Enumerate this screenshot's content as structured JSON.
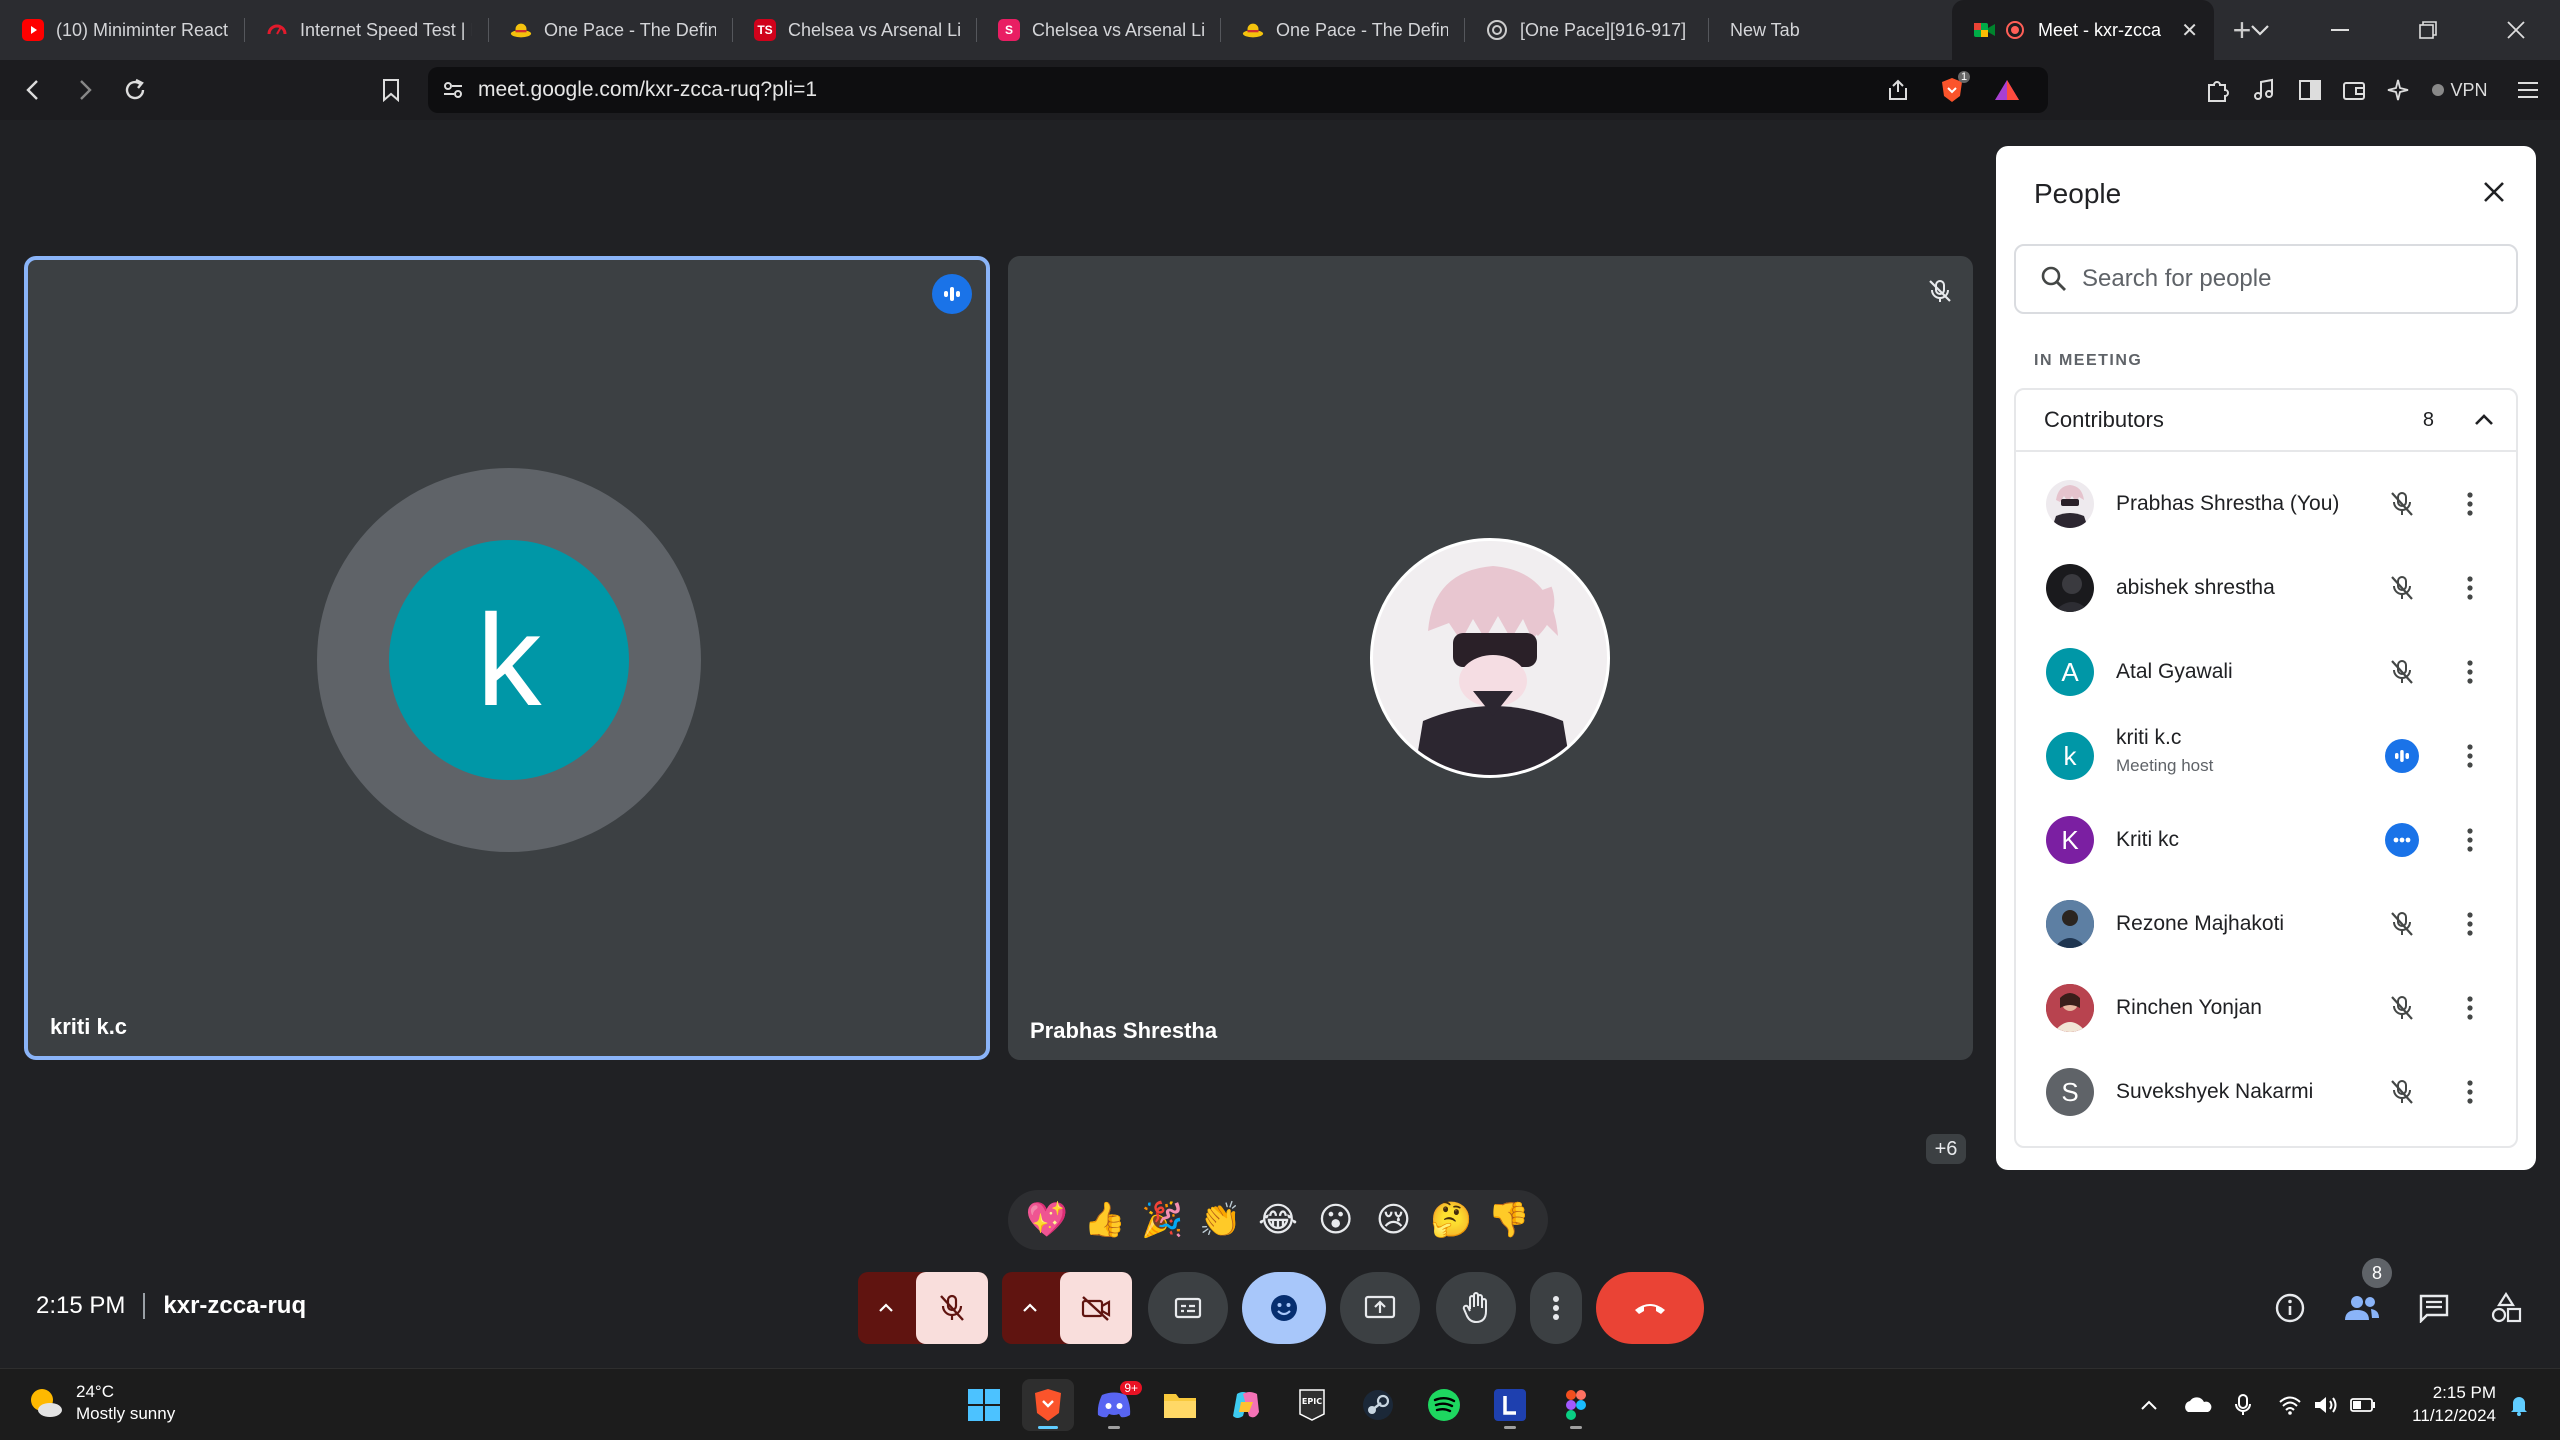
{
  "browser": {
    "tabs": [
      {
        "label": "(10) Miniminter React",
        "favicon": "youtube-icon",
        "color": "#ff0000"
      },
      {
        "label": "Internet Speed Test | F",
        "favicon": "speedtest-icon",
        "color": "#e21a2c"
      },
      {
        "label": "One Pace - The Definit",
        "favicon": "strawhat-icon",
        "color": "#f4c20d"
      },
      {
        "label": "Chelsea vs Arsenal Liv",
        "favicon": "ts-icon",
        "color": "#d0021b"
      },
      {
        "label": "Chelsea vs Arsenal Liv",
        "favicon": "s-icon",
        "color": "#e91e63"
      },
      {
        "label": "One Pace - The Definit",
        "favicon": "strawhat-icon",
        "color": "#f4c20d"
      },
      {
        "label": "[One Pace][916-917] ",
        "favicon": "opera-icon",
        "color": "#cccccc"
      },
      {
        "label": "New Tab",
        "favicon": "",
        "color": ""
      },
      {
        "label": "Meet - kxr-zcca",
        "favicon": "meet-icon",
        "color": "#00ac47",
        "active": true
      }
    ],
    "url": "meet.google.com/kxr-zcca-ruq?pli=1",
    "vpn_label": "VPN",
    "shields_badge": "1"
  },
  "meet": {
    "tiles": [
      {
        "name": "kriti k.c",
        "initial": "k"
      },
      {
        "name": "Prabhas Shrestha"
      }
    ],
    "more_count": "+6",
    "reactions": [
      "💖",
      "👍",
      "🎉",
      "👏",
      "😂",
      "😮",
      "😢",
      "🤔",
      "👎"
    ],
    "time": "2:15 PM",
    "code": "kxr-zcca-ruq",
    "people_badge": "8"
  },
  "people_panel": {
    "title": "People",
    "search_placeholder": "Search for people",
    "section_label": "IN MEETING",
    "group_label": "Contributors",
    "group_count": "8",
    "people": [
      {
        "name": "Prabhas Shrestha (You)",
        "avatar": "photo",
        "status": "muted"
      },
      {
        "name": "abishek shrestha",
        "avatar": "photo-dark",
        "status": "muted"
      },
      {
        "name": "Atal Gyawali",
        "initial": "A",
        "color": "#0097a7",
        "status": "muted"
      },
      {
        "name": "kriti k.c",
        "subtitle": "Meeting host",
        "initial": "k",
        "color": "#0097a7",
        "status": "speaking"
      },
      {
        "name": "Kriti kc",
        "initial": "K",
        "color": "#7b1fa2",
        "status": "dots"
      },
      {
        "name": "Rezone Majhakoti",
        "avatar": "photo-blue",
        "status": "muted"
      },
      {
        "name": "Rinchen Yonjan",
        "avatar": "photo-red",
        "status": "muted"
      },
      {
        "name": "Suvekshyek Nakarmi",
        "initial": "S",
        "color": "#5f6368",
        "status": "muted"
      }
    ]
  },
  "taskbar": {
    "weather_temp": "24°C",
    "weather_desc": "Mostly sunny",
    "clock_time": "2:15 PM",
    "clock_date": "11/12/2024",
    "discord_badge": "9+",
    "apps": [
      "windows-start",
      "brave",
      "discord",
      "file-explorer",
      "copilot",
      "epic-games",
      "steam",
      "spotify",
      "l-app",
      "figma"
    ]
  }
}
